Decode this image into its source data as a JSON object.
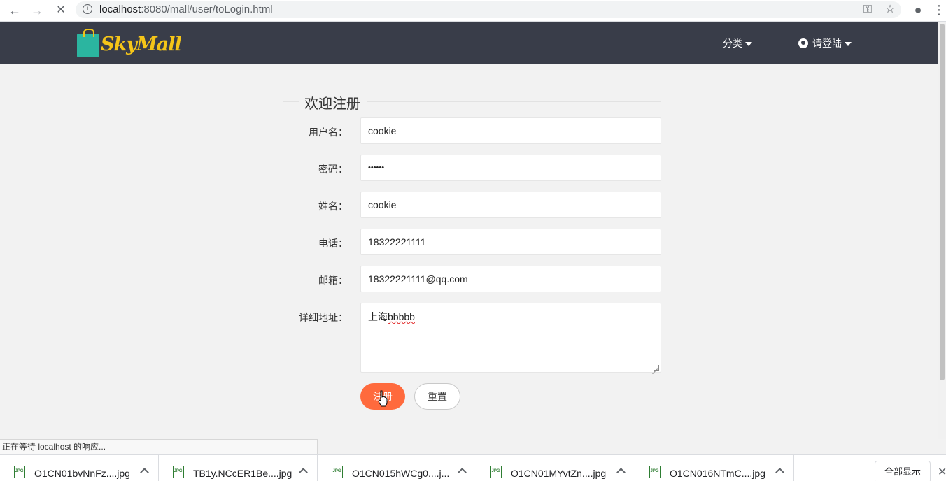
{
  "browser": {
    "back_icon": "←",
    "forward_icon": "→",
    "reload_icon": "✕",
    "url_host": "localhost",
    "url_rest": ":8080/mall/user/toLogin.html",
    "key_icon": "⚿",
    "star_icon": "☆",
    "menu_icon": "⋮"
  },
  "header": {
    "logo_text": "SkyMall",
    "menu_category": "分类",
    "menu_login": "请登陆",
    "bg_color": "#393d49",
    "logo_color": "#f5c518"
  },
  "form": {
    "legend": "欢迎注册",
    "fields": [
      {
        "label": "用户名：",
        "value": "cookie"
      },
      {
        "label": "密码：",
        "value": "••••••"
      },
      {
        "label": "姓名：",
        "value": "cookie"
      },
      {
        "label": "电话：",
        "value": "18322221111"
      },
      {
        "label": "邮箱：",
        "value": "18322221111@qq.com"
      }
    ],
    "address_label": "详细地址：",
    "address_value_prefix": "上海",
    "address_value_suffix": "bbbbb",
    "submit_label": "注册",
    "reset_label": "重置",
    "accent_color": "#ff6a3d"
  },
  "status_text": "正在等待 localhost 的响应...",
  "downloads": {
    "items": [
      "O1CN01bvNnFz....jpg",
      "TB1y.NCcER1Be....jpg",
      "O1CN015hWCg0....j...",
      "O1CN01MYvtZn....jpg",
      "O1CN016NTmC....jpg"
    ],
    "show_all": "全部显示",
    "close_icon": "✕"
  }
}
